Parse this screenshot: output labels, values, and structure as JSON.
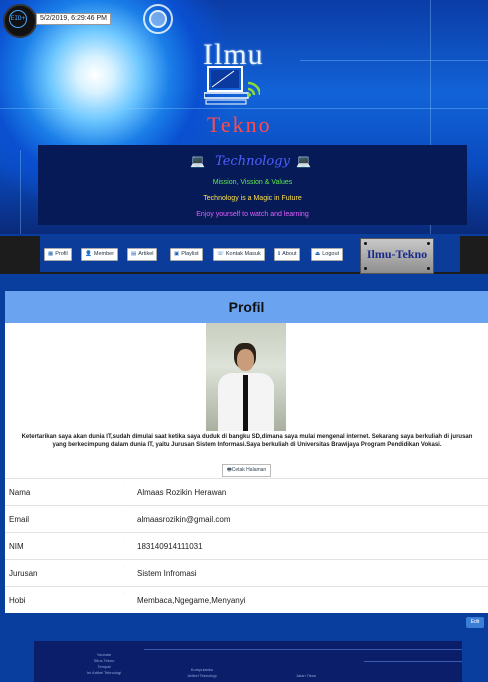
{
  "header": {
    "clock_label": "EID+",
    "datetime": "5/2/2019, 6:29:46 PM",
    "logo_top": "Ilmu",
    "logo_bottom": "Tekno",
    "tech_title": "Technology",
    "taglines": [
      "Mission, Vission & Values",
      "Technology is a Magic in Future",
      "Enjoy yourself to watch and learning"
    ],
    "tagline_colors": [
      "#5ee84a",
      "#ffe04a",
      "#e060ff"
    ]
  },
  "nav": {
    "items": [
      {
        "icon": "▦",
        "label": "Profil"
      },
      {
        "icon": "👤",
        "label": "Member"
      },
      {
        "icon": "▤",
        "label": "Artikel"
      },
      {
        "icon": "▣",
        "label": "Playlist"
      },
      {
        "icon": "☏",
        "label": "Kontak Masuk"
      },
      {
        "icon": "ℹ",
        "label": "About"
      },
      {
        "icon": "⏏",
        "label": "Logout"
      }
    ],
    "brand": "Ilmu-Tekno"
  },
  "profile": {
    "title": "Profil",
    "bio": "Ketertarikan saya akan dunia IT,sudah dimulai saat ketika saya duduk di bangku SD,dimana saya mulai mengenal internet. Sekarang saya berkuliah di jurusan yang berkecimpung dalam dunia IT, yaitu Jurusan Sistem Informasi.Saya berkuliah di Universitas Brawijaya Program Pendidikan Vokasi.",
    "print_label": "Cetak Halaman",
    "rows": [
      {
        "label": "Nama",
        "value": "Almaas Rozikin Herawan"
      },
      {
        "label": "Email",
        "value": "almaasrozikin@gmail.com"
      },
      {
        "label": "NIM",
        "value": "183140914111031"
      },
      {
        "label": "Jurusan",
        "value": "Sistem Infromasi"
      },
      {
        "label": "Hobi",
        "value": "Membaca,Ngegame,Menyanyi"
      }
    ],
    "edit_label": "Edit"
  },
  "footer": {
    "col1": [
      "Youtube",
      "Situs Tekno",
      "Tempat",
      "Ini Artikel Teknologi"
    ],
    "col2": [
      "Kumpulanku",
      "Artikel Teknologi"
    ],
    "col3": [
      "Jalan Tikus"
    ]
  }
}
